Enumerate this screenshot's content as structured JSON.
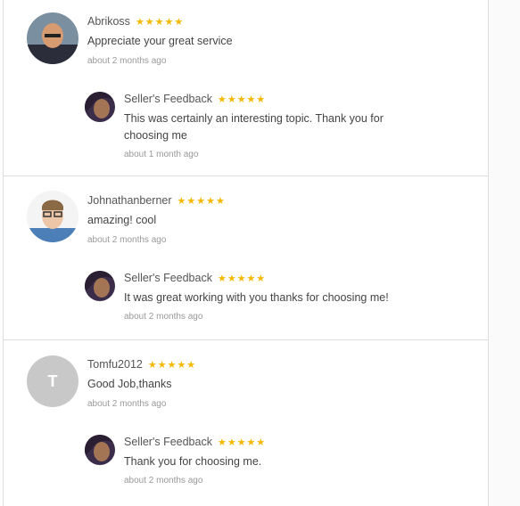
{
  "reviews": [
    {
      "name": "Abrikoss",
      "stars": "★★★★★",
      "comment": "Appreciate your great service",
      "time": "about 2 months ago",
      "avatar_icon": "person-photo",
      "reply": {
        "name": "Seller's Feedback",
        "stars": "★★★★★",
        "comment": "This was certainly an interesting topic. Thank you for choosing me",
        "time": "about 1 month ago"
      }
    },
    {
      "name": "Johnathanberner",
      "stars": "★★★★★",
      "comment": "amazing! cool",
      "time": "about 2 months ago",
      "avatar_icon": "person-photo",
      "reply": {
        "name": "Seller's Feedback",
        "stars": "★★★★★",
        "comment": "It was great working with you thanks for choosing me!",
        "time": "about 2 months ago"
      }
    },
    {
      "name": "Tomfu2012",
      "stars": "★★★★★",
      "comment": "Good Job,thanks",
      "time": "about 2 months ago",
      "avatar_initial": "T",
      "reply": {
        "name": "Seller's Feedback",
        "stars": "★★★★★",
        "comment": "Thank you for choosing me.",
        "time": "about 2 months ago"
      }
    }
  ],
  "colors": {
    "star": "#f5b800",
    "divider": "#dddddd"
  }
}
